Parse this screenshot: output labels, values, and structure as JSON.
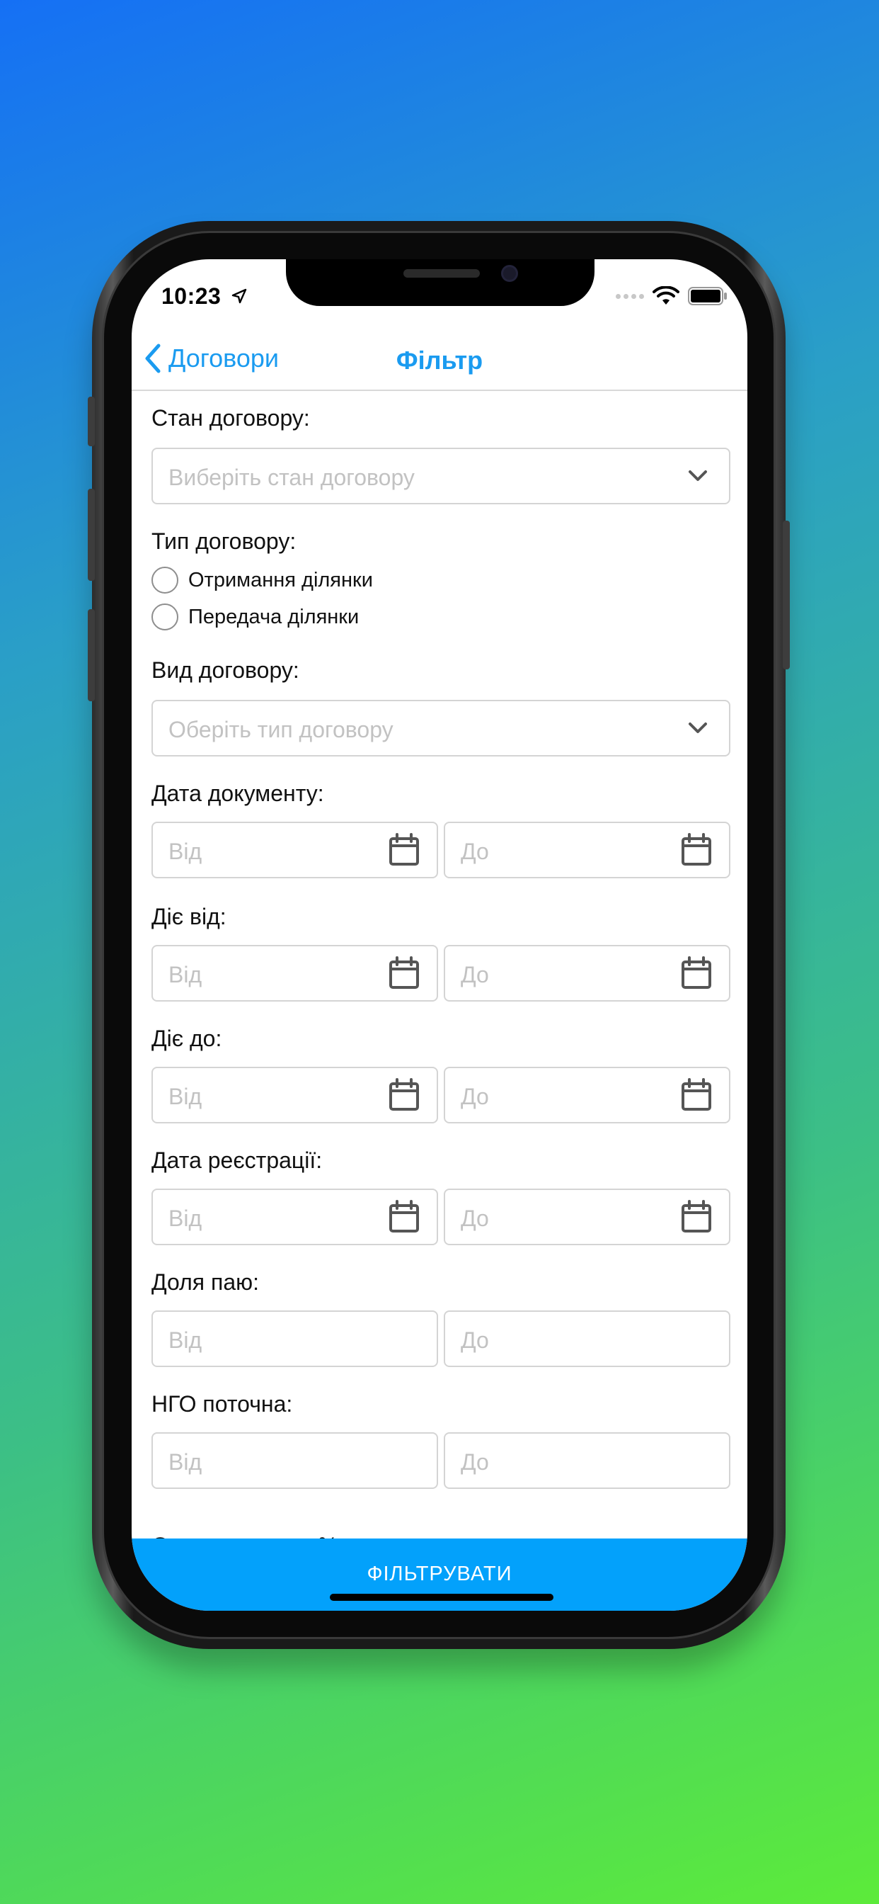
{
  "status_bar": {
    "time": "10:23"
  },
  "nav": {
    "back_label": "Договори",
    "title": "Фільтр"
  },
  "form": {
    "contract_state": {
      "label": "Стан договору:",
      "placeholder": "Виберіть стан договору"
    },
    "contract_type": {
      "label": "Тип договору:",
      "options": [
        "Отримання ділянки",
        "Передача ділянки"
      ]
    },
    "contract_kind": {
      "label": "Вид договору:",
      "placeholder": "Оберіть тип договору"
    },
    "document_date": {
      "label": "Дата документу:",
      "from": "Від",
      "to": "До"
    },
    "valid_from": {
      "label": "Діє від:",
      "from": "Від",
      "to": "До"
    },
    "valid_to": {
      "label": "Діє до:",
      "from": "Від",
      "to": "До"
    },
    "registration_date": {
      "label": "Дата реєстрації:",
      "from": "Від",
      "to": "До"
    },
    "share": {
      "label": "Доля паю:",
      "from": "Від",
      "to": "До"
    },
    "ngo": {
      "label": "НГО поточна:",
      "from": "Від",
      "to": "До"
    },
    "rent_partial": {
      "label": "Орендна плата %:"
    }
  },
  "footer": {
    "filter_button": "ФІЛЬТРУВАТИ"
  },
  "colors": {
    "accent": "#1a9bf0",
    "button": "#03a1fb"
  }
}
